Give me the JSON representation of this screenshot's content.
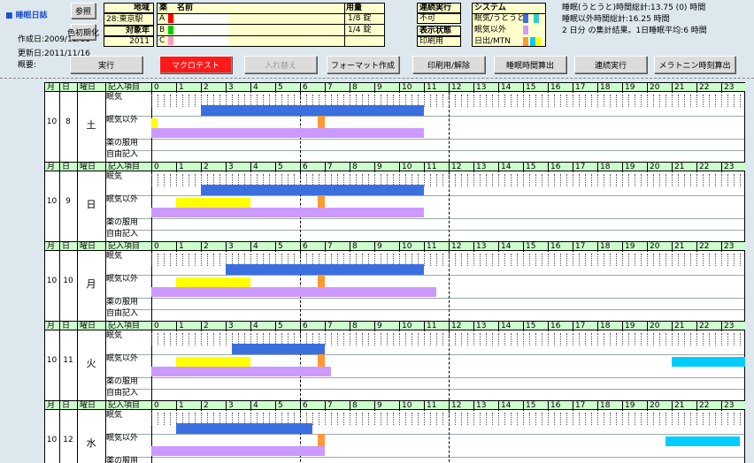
{
  "app": {
    "title": "睡眠日誌",
    "created": "作成日:2009/12/11",
    "updated": "更新日:2011/11/16",
    "summary_label": "概要:"
  },
  "buttons": {
    "ref": "参照",
    "color_init": "色初期化",
    "run": "実行",
    "macro_test": "マクロテスト",
    "swap": "入れ替え",
    "format": "フォーマット作成",
    "print": "印刷用/解除",
    "sleep_calc": "睡眠時間算出",
    "continuous": "連続実行",
    "melatonin": "メラトニン時刻算出"
  },
  "region": {
    "header": "地域",
    "value": "28:東京駅",
    "year_header": "対象年",
    "year": "2011"
  },
  "meds": {
    "h_med": "薬",
    "h_name": "名前",
    "h_dose": "用量",
    "rows": [
      {
        "id": "A",
        "name": "",
        "dose": "1/8 錠",
        "color": "#ff0000"
      },
      {
        "id": "B",
        "name": "",
        "dose": "1/4 錠",
        "color": "#00cc00"
      },
      {
        "id": "C",
        "name": "",
        "dose": "",
        "color": "#ff99cc"
      }
    ]
  },
  "cont": {
    "header": "連続実行",
    "value": "不可",
    "disp_header": "表示状態",
    "disp_value": "印刷用"
  },
  "system": {
    "header": "システム",
    "rows": [
      "眠気/うとうと",
      "眠気以外",
      "日出/MTN"
    ]
  },
  "stats": {
    "l1": "睡眠(うとうと)時間総計:13.75 (0) 時間",
    "l2": "睡眠以外時間総計:16.25 時間",
    "l3": "2 日分 の集計結果。1日睡眠平均:6 時間"
  },
  "grid": {
    "headers": {
      "month": "月",
      "day": "日",
      "weekday": "曜日",
      "entry": "記入項目"
    },
    "hours": [
      "0",
      "1",
      "2",
      "3",
      "4",
      "5",
      "6",
      "7",
      "8",
      "9",
      "10",
      "11",
      "12",
      "13",
      "14",
      "15",
      "16",
      "17",
      "18",
      "19",
      "20",
      "21",
      "22",
      "23"
    ],
    "row_labels": {
      "sleepy": "眠気",
      "other": "眠気以外",
      "med": "薬の服用",
      "free": "自由記入"
    },
    "colors": {
      "sleep": "#3b6fe0",
      "yellow": "#ffff00",
      "purple": "#cc99ff",
      "orange": "#ff9933",
      "cyan": "#00ccff"
    },
    "days": [
      {
        "month": "10",
        "day": "8",
        "weekday": "土",
        "sleep": [
          2,
          11
        ],
        "yellow": [
          0,
          0.25
        ],
        "purple": [
          0,
          11
        ],
        "orange": [
          6.7,
          7
        ],
        "cyan": null
      },
      {
        "month": "10",
        "day": "9",
        "weekday": "日",
        "sleep": [
          2,
          11
        ],
        "yellow": [
          1,
          4
        ],
        "purple": [
          0,
          11
        ],
        "orange": [
          6.7,
          7
        ],
        "cyan": null
      },
      {
        "month": "10",
        "day": "10",
        "weekday": "月",
        "sleep": [
          3,
          11
        ],
        "yellow": [
          1,
          4
        ],
        "purple": [
          0,
          11.5
        ],
        "orange": [
          6.7,
          7
        ],
        "cyan": null
      },
      {
        "month": "10",
        "day": "11",
        "weekday": "火",
        "sleep": [
          3.25,
          7
        ],
        "yellow": [
          1,
          4
        ],
        "purple": [
          0,
          7.25
        ],
        "orange": [
          6.7,
          7
        ],
        "cyan": [
          21,
          24
        ]
      },
      {
        "month": "10",
        "day": "12",
        "weekday": "水",
        "sleep": [
          1,
          6.5
        ],
        "yellow": null,
        "purple": [
          0,
          7
        ],
        "orange": [
          6.7,
          7
        ],
        "cyan": [
          20.75,
          23.75
        ]
      }
    ]
  }
}
